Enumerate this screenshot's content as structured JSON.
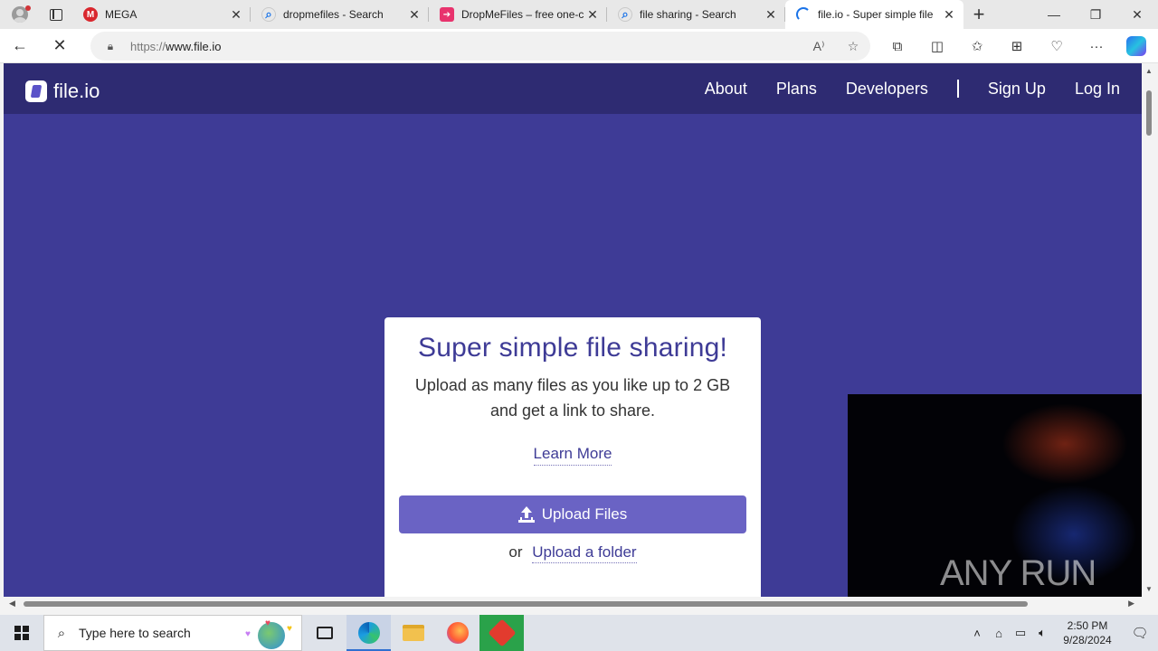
{
  "browser": {
    "tabs": [
      {
        "title": "MEGA",
        "icon": "mega-icon",
        "active": false
      },
      {
        "title": "dropmefiles - Search",
        "icon": "search-icon",
        "active": false
      },
      {
        "title": "DropMeFiles – free one-c",
        "icon": "dropmefiles-icon",
        "active": false
      },
      {
        "title": "file sharing - Search",
        "icon": "search-icon",
        "active": false
      },
      {
        "title": "file.io - Super simple file",
        "icon": "loading-icon",
        "active": true
      }
    ],
    "url_prefix": "https://",
    "url_host": "www.file.io"
  },
  "site": {
    "logo_text": "file.io",
    "nav": {
      "about": "About",
      "plans": "Plans",
      "developers": "Developers",
      "signup": "Sign Up",
      "login": "Log In"
    },
    "card": {
      "title": "Super simple file sharing!",
      "line1": "Upload as many files as you like up to 2 GB",
      "line2": "and get a link to share.",
      "learn_more": "Learn More",
      "upload_button": "Upload Files",
      "or": "or",
      "upload_folder": "Upload a folder"
    },
    "watermark": "ANY RUN"
  },
  "taskbar": {
    "search_placeholder": "Type here to search",
    "time": "2:50 PM",
    "date": "9/28/2024"
  },
  "colors": {
    "page_bg": "#3e3b96",
    "header_bg": "#2e2b72",
    "button": "#6a63c4"
  }
}
